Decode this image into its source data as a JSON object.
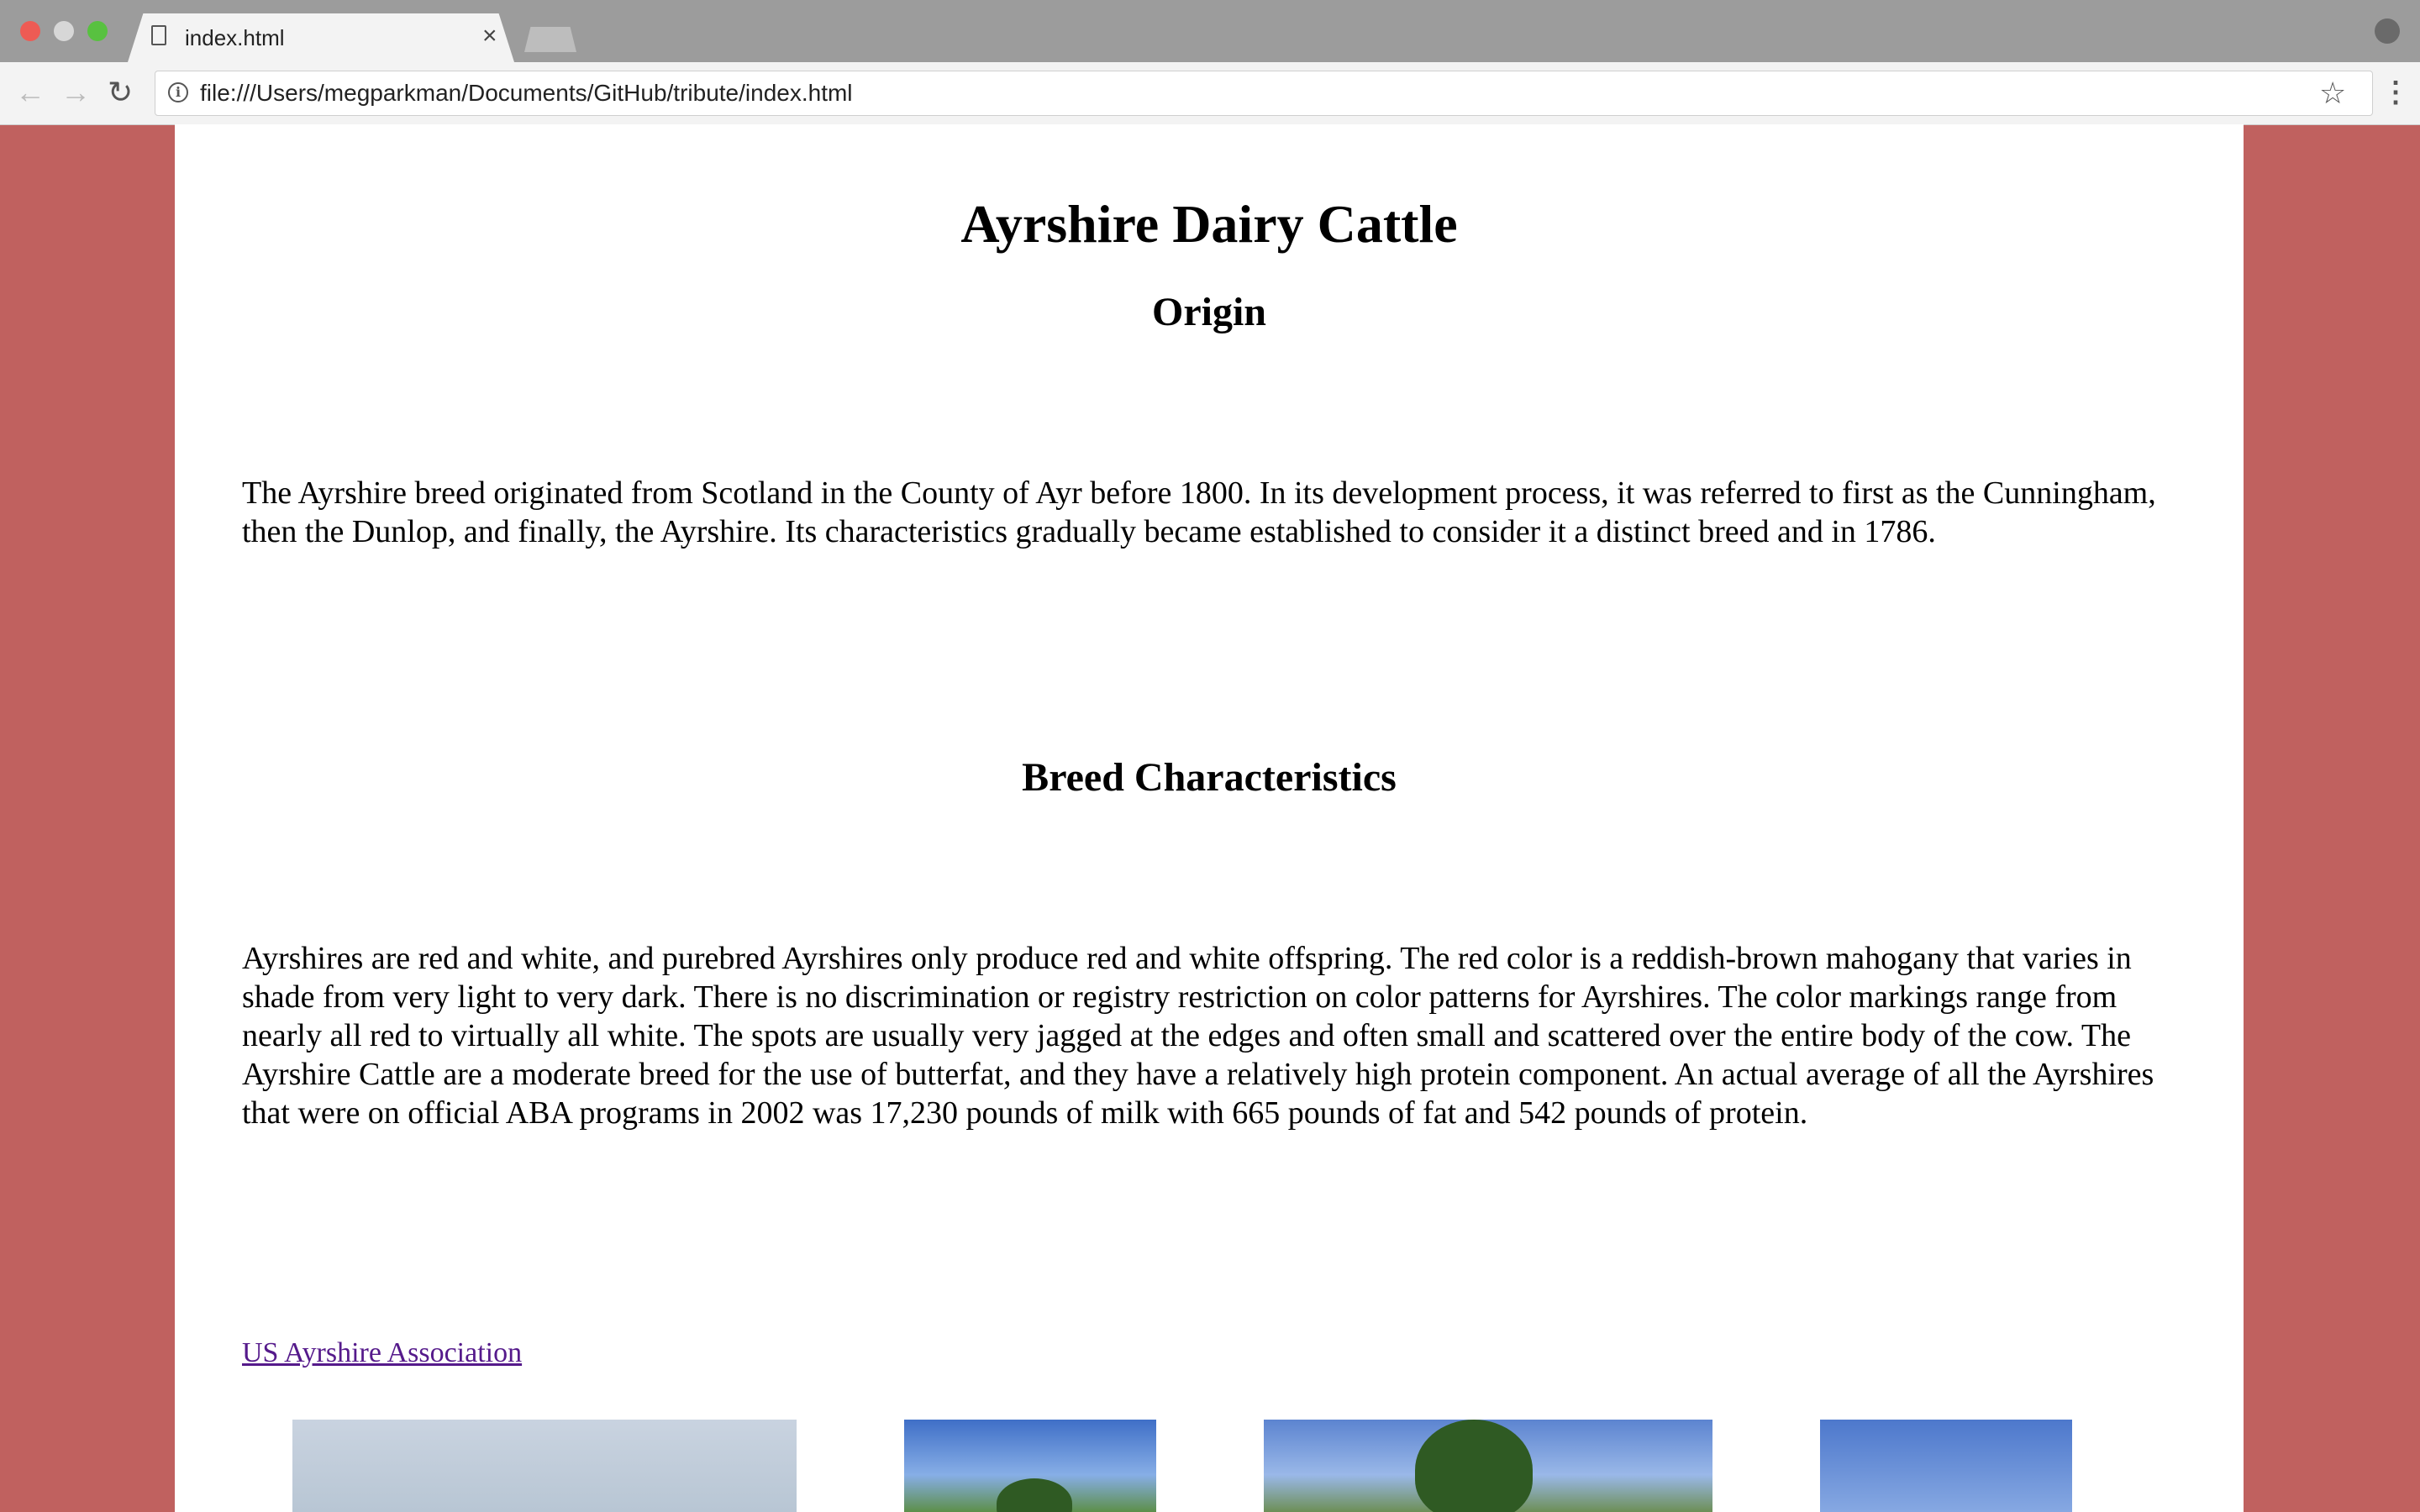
{
  "browser": {
    "tab_title": "index.html",
    "tab_close": "×",
    "url": "file:///Users/megparkman/Documents/GitHub/tribute/index.html",
    "icons": {
      "back": "back-arrow-icon",
      "forward": "forward-arrow-icon",
      "reload": "reload-icon",
      "info": "info-icon",
      "bookmark": "star-icon",
      "menu": "kebab-menu-icon",
      "profile": "profile-icon"
    }
  },
  "page": {
    "title": "Ayrshire Dairy Cattle",
    "origin_heading": "Origin",
    "origin_text": "The Ayrshire breed originated from Scotland in the County of Ayr before 1800. In its development process, it was referred to first as the Cunningham, then the Dunlop, and finally, the Ayrshire. Its characteristics gradually became established to consider it a distinct breed and in 1786.",
    "breed_heading": "Breed Characteristics",
    "breed_text": "Ayrshires are red and white, and purebred Ayrshires only produce red and white offspring. The red color is a reddish-brown mahogany that varies in shade from very light to very dark. There is no discrimination or registry restriction on color patterns for Ayrshires. The color markings range from nearly all red to virtually all white. The spots are usually very jagged at the edges and often small and scattered over the entire body of the cow. The Ayrshire Cattle are a moderate breed for the use of butterfat, and they have a relatively high protein component. An actual average of all the Ayrshires that were on official ABA programs in 2002 was 17,230 pounds of milk with 665 pounds of fat and 542 pounds of protein.",
    "link_text": "US Ayrshire Association"
  },
  "colors": {
    "background": "#c0615f",
    "content": "#ffffff",
    "visited_link": "#551a8b"
  }
}
